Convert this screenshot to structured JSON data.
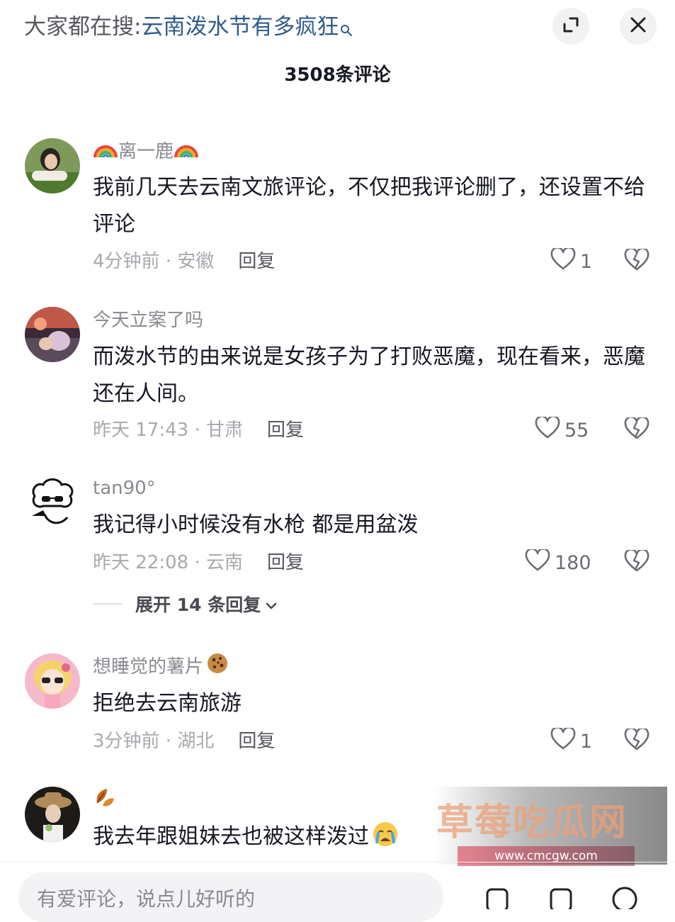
{
  "header": {
    "search_prefix": "大家都在搜:",
    "search_term": "云南泼水节有多疯狂",
    "expand_icon": "expand-icon",
    "close_icon": "close-icon"
  },
  "comment_count_title": "3508条评论",
  "comments": [
    {
      "username": "离一鹿",
      "username_emoji": "rainbow",
      "text": "我前几天去云南文旅评论，不仅把我评论删了，还设置不给评论",
      "meta": "4分钟前 · 安徽",
      "reply_label": "回复",
      "likes": "1"
    },
    {
      "username": "今天立案了吗",
      "text": "而泼水节的由来说是女孩子为了打败恶魔，现在看来，恶魔还在人间。",
      "meta": "昨天 17:43 · 甘肃",
      "reply_label": "回复",
      "likes": "55"
    },
    {
      "username": "tan90°",
      "text": "我记得小时候没有水枪  都是用盆泼",
      "meta": "昨天 22:08 · 云南",
      "reply_label": "回复",
      "likes": "180",
      "expand_label": "展开 14 条回复"
    },
    {
      "username": "想睡觉的薯片",
      "username_emoji": "cookie",
      "text": "拒绝去云南旅游",
      "meta": "3分钟前 · 湖北",
      "reply_label": "回复",
      "likes": "1"
    },
    {
      "username": "",
      "username_emoji": "autumn-leaves",
      "text": "我去年跟姐妹去也被这样泼过",
      "text_emoji": "crying-face"
    }
  ],
  "watermark": {
    "title": "草莓吃瓜网",
    "url": "www.cmcgw.com"
  },
  "input": {
    "placeholder": "有爱评论，说点儿好听的"
  },
  "colors": {
    "search_term": "#2f5c8c",
    "text": "#161823",
    "meta": "#a8a9ae"
  }
}
